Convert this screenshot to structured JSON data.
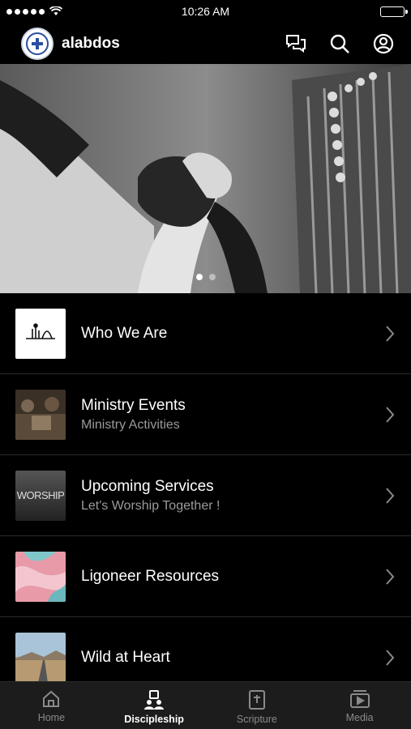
{
  "status_bar": {
    "time": "10:26 AM"
  },
  "header": {
    "app_name": "alabdos"
  },
  "hero": {
    "pages": 2,
    "active_page": 1
  },
  "list": {
    "items": [
      {
        "title": "Who We Are",
        "subtitle": ""
      },
      {
        "title": "Ministry Events",
        "subtitle": "Ministry Activities"
      },
      {
        "title": "Upcoming Services",
        "subtitle": "Let's Worship Together !",
        "thumb_text": "WORSHIP"
      },
      {
        "title": "Ligoneer Resources",
        "subtitle": ""
      },
      {
        "title": "Wild at Heart",
        "subtitle": ""
      }
    ]
  },
  "tabbar": {
    "tabs": [
      {
        "label": "Home",
        "icon": "home-icon",
        "active": false
      },
      {
        "label": "Discipleship",
        "icon": "discipleship-icon",
        "active": true
      },
      {
        "label": "Scripture",
        "icon": "bible-icon",
        "active": false
      },
      {
        "label": "Media",
        "icon": "media-icon",
        "active": false
      }
    ]
  },
  "colors": {
    "background": "#000000",
    "tabbar": "#1c1c1c",
    "subtitle": "#9a9a9a",
    "inactive_tab": "#8a8a8a"
  }
}
